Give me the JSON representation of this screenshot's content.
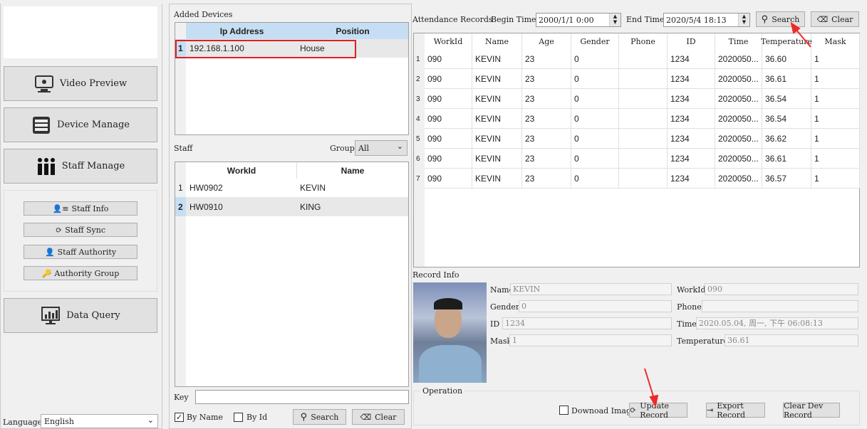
{
  "nav": {
    "video_preview": "Video Preview",
    "device_manage": "Device Manage",
    "staff_manage": "Staff Manage",
    "staff_info": "Staff Info",
    "staff_sync": "Staff Sync",
    "staff_authority": "Staff Authority",
    "authority_group": "Authority Group",
    "data_query": "Data Query",
    "language_label": "Language",
    "language_value": "English"
  },
  "devices": {
    "title": "Added Devices",
    "columns": [
      "Ip Address",
      "Position"
    ],
    "rows": [
      {
        "num": "1",
        "ip": "192.168.1.100",
        "position": "House"
      }
    ]
  },
  "staff": {
    "title": "Staff",
    "group_label": "Group",
    "group_value": "All",
    "columns": [
      "WorkId",
      "Name"
    ],
    "rows": [
      {
        "num": "1",
        "workid": "HW0902",
        "name": "KEVIN"
      },
      {
        "num": "2",
        "workid": "HW0910",
        "name": "KING"
      }
    ],
    "key_label": "Key",
    "key_value": "",
    "by_name": "By Name",
    "by_name_checked": true,
    "by_id": "By Id",
    "by_id_checked": false,
    "search": "Search",
    "clear": "Clear"
  },
  "records": {
    "title": "Attendance Records",
    "begin_label": "Begin Time",
    "begin_value": "2000/1/1 0:00",
    "end_label": "End Time",
    "end_value": "2020/5/4 18:13",
    "search": "Search",
    "clear": "Clear",
    "columns": [
      "WorkId",
      "Name",
      "Age",
      "Gender",
      "Phone",
      "ID",
      "Time",
      "Temperature",
      "Mask"
    ],
    "rows": [
      [
        "090",
        "KEVIN",
        "23",
        "0",
        "",
        "1234",
        "2020050...",
        "36.60",
        "1"
      ],
      [
        "090",
        "KEVIN",
        "23",
        "0",
        "",
        "1234",
        "2020050...",
        "36.61",
        "1"
      ],
      [
        "090",
        "KEVIN",
        "23",
        "0",
        "",
        "1234",
        "2020050...",
        "36.54",
        "1"
      ],
      [
        "090",
        "KEVIN",
        "23",
        "0",
        "",
        "1234",
        "2020050...",
        "36.54",
        "1"
      ],
      [
        "090",
        "KEVIN",
        "23",
        "0",
        "",
        "1234",
        "2020050...",
        "36.62",
        "1"
      ],
      [
        "090",
        "KEVIN",
        "23",
        "0",
        "",
        "1234",
        "2020050...",
        "36.61",
        "1"
      ],
      [
        "090",
        "KEVIN",
        "23",
        "0",
        "",
        "1234",
        "2020050...",
        "36.57",
        "1"
      ]
    ]
  },
  "record_info": {
    "title": "Record Info",
    "name_label": "Name",
    "name": "KEVIN",
    "workid_label": "WorkId",
    "workid": "090",
    "gender_label": "Gender",
    "gender": "0",
    "phone_label": "Phone",
    "phone": "",
    "id_label": "ID",
    "id": "1234",
    "time_label": "Time",
    "time": "2020.05.04, 周一, 下午 06:08:13",
    "mask_label": "Mask",
    "mask": "1",
    "temperature_label": "Temperature",
    "temperature": "36.61"
  },
  "operation": {
    "title": "Operation",
    "download_image": "Downoad Image",
    "download_checked": false,
    "update_record": "Update Record",
    "export_record": "Export Record",
    "clear_dev_record": "Clear Dev Record"
  },
  "colors": {
    "header_blue": "#c6def3",
    "selection_red": "#e02020",
    "annotation_arrow": "#ee2a2a"
  }
}
